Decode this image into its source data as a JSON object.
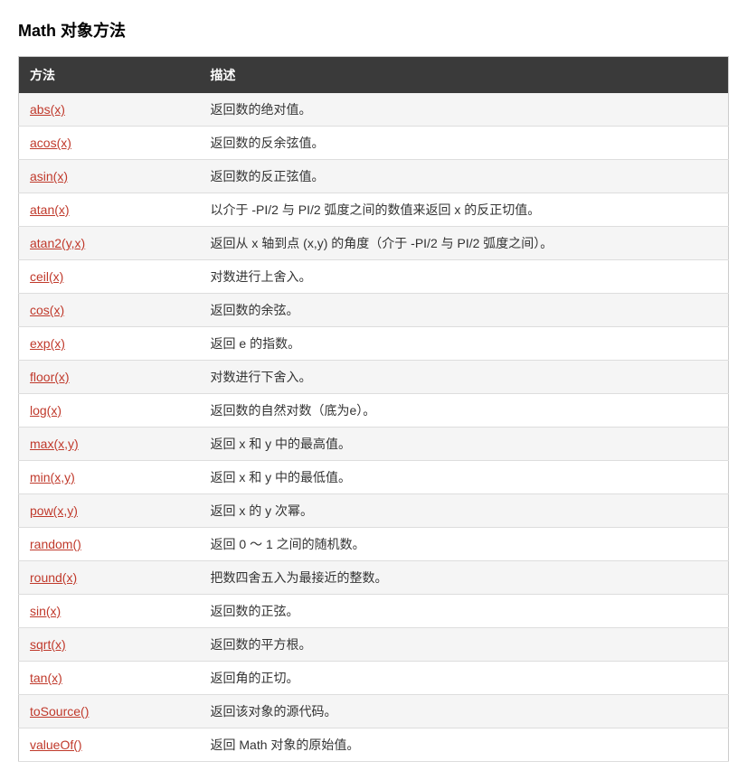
{
  "page": {
    "title": "Math 对象方法"
  },
  "table": {
    "headers": [
      {
        "id": "method",
        "label": "方法"
      },
      {
        "id": "description",
        "label": "描述"
      }
    ],
    "rows": [
      {
        "method": "abs(x)",
        "description": "返回数的绝对值。"
      },
      {
        "method": "acos(x)",
        "description": "返回数的反余弦值。"
      },
      {
        "method": "asin(x)",
        "description": "返回数的反正弦值。"
      },
      {
        "method": "atan(x)",
        "description": "以介于 -PI/2 与 PI/2 弧度之间的数值来返回 x 的反正切值。"
      },
      {
        "method": "atan2(y,x)",
        "description": "返回从 x 轴到点 (x,y) 的角度（介于 -PI/2 与 PI/2 弧度之间）。"
      },
      {
        "method": "ceil(x)",
        "description": "对数进行上舍入。"
      },
      {
        "method": "cos(x)",
        "description": "返回数的余弦。"
      },
      {
        "method": "exp(x)",
        "description": "返回 e 的指数。"
      },
      {
        "method": "floor(x)",
        "description": "对数进行下舍入。"
      },
      {
        "method": "log(x)",
        "description": "返回数的自然对数（底为e）。"
      },
      {
        "method": "max(x,y)",
        "description": "返回 x 和 y 中的最高值。"
      },
      {
        "method": "min(x,y)",
        "description": "返回 x 和 y 中的最低值。"
      },
      {
        "method": "pow(x,y)",
        "description": "返回 x 的 y 次幂。"
      },
      {
        "method": "random()",
        "description": "返回 0 ～ 1 之间的随机数。"
      },
      {
        "method": "round(x)",
        "description": "把数四舍五入为最接近的整数。"
      },
      {
        "method": "sin(x)",
        "description": "返回数的正弦。"
      },
      {
        "method": "sqrt(x)",
        "description": "返回数的平方根。"
      },
      {
        "method": "tan(x)",
        "description": "返回角的正切。"
      },
      {
        "method": "toSource()",
        "description": "返回该对象的源代码。"
      },
      {
        "method": "valueOf()",
        "description": "返回 Math 对象的原始值。"
      }
    ]
  }
}
